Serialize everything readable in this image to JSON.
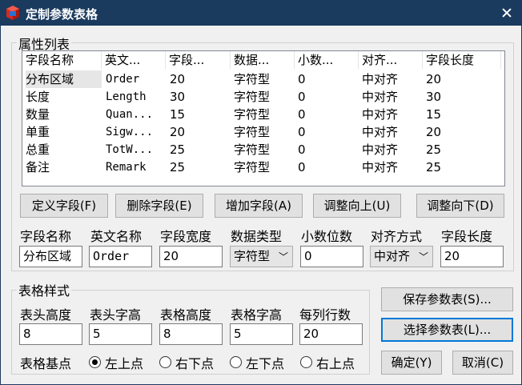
{
  "window": {
    "title": "定制参数表格"
  },
  "props_group": {
    "legend": "属性列表"
  },
  "list": {
    "headers": [
      "字段名称",
      "英文...",
      "字段...",
      "数据...",
      "小数...",
      "对齐...",
      "字段长度"
    ],
    "rows": [
      [
        "分布区域",
        "Order",
        "20",
        "字符型",
        "0",
        "中对齐",
        "20"
      ],
      [
        "长度",
        "Length",
        "30",
        "字符型",
        "0",
        "中对齐",
        "30"
      ],
      [
        "数量",
        "Quan...",
        "15",
        "字符型",
        "0",
        "中对齐",
        "15"
      ],
      [
        "单重",
        "Sigw...",
        "20",
        "字符型",
        "0",
        "中对齐",
        "20"
      ],
      [
        "总重",
        "TotW...",
        "25",
        "字符型",
        "0",
        "中对齐",
        "25"
      ],
      [
        "备注",
        "Remark",
        "25",
        "字符型",
        "0",
        "中对齐",
        "25"
      ]
    ]
  },
  "field_buttons": {
    "define": "定义字段(F)",
    "delete": "删除字段(E)",
    "add": "增加字段(A)",
    "up": "调整向上(U)",
    "down": "调整向下(D)"
  },
  "field_editor": {
    "labels": {
      "name": "字段名称",
      "en_name": "英文名称",
      "width": "字段宽度",
      "type": "数据类型",
      "decimals": "小数位数",
      "align": "对齐方式",
      "length": "字段长度"
    },
    "values": {
      "name": "分布区域",
      "en_name": "Order",
      "width": "20",
      "type": "字符型",
      "decimals": "0",
      "align": "中对齐",
      "length": "20"
    }
  },
  "table_style": {
    "legend": "表格样式",
    "labels": {
      "head_height": "表头高度",
      "head_font": "表头字高",
      "table_height": "表格高度",
      "table_font": "表格字高",
      "rows_per_col": "每列行数"
    },
    "values": {
      "head_height": "8",
      "head_font": "5",
      "table_height": "8",
      "table_font": "5",
      "rows_per_col": "20"
    },
    "base_point_label": "表格基点",
    "base_point_options": [
      "左上点",
      "右下点",
      "左下点",
      "右上点"
    ],
    "base_point_selected": "左上点"
  },
  "action_buttons": {
    "save": "保存参数表(S)...",
    "select": "选择参数表(L)...",
    "ok": "确定(Y)",
    "cancel": "取消(C)"
  }
}
